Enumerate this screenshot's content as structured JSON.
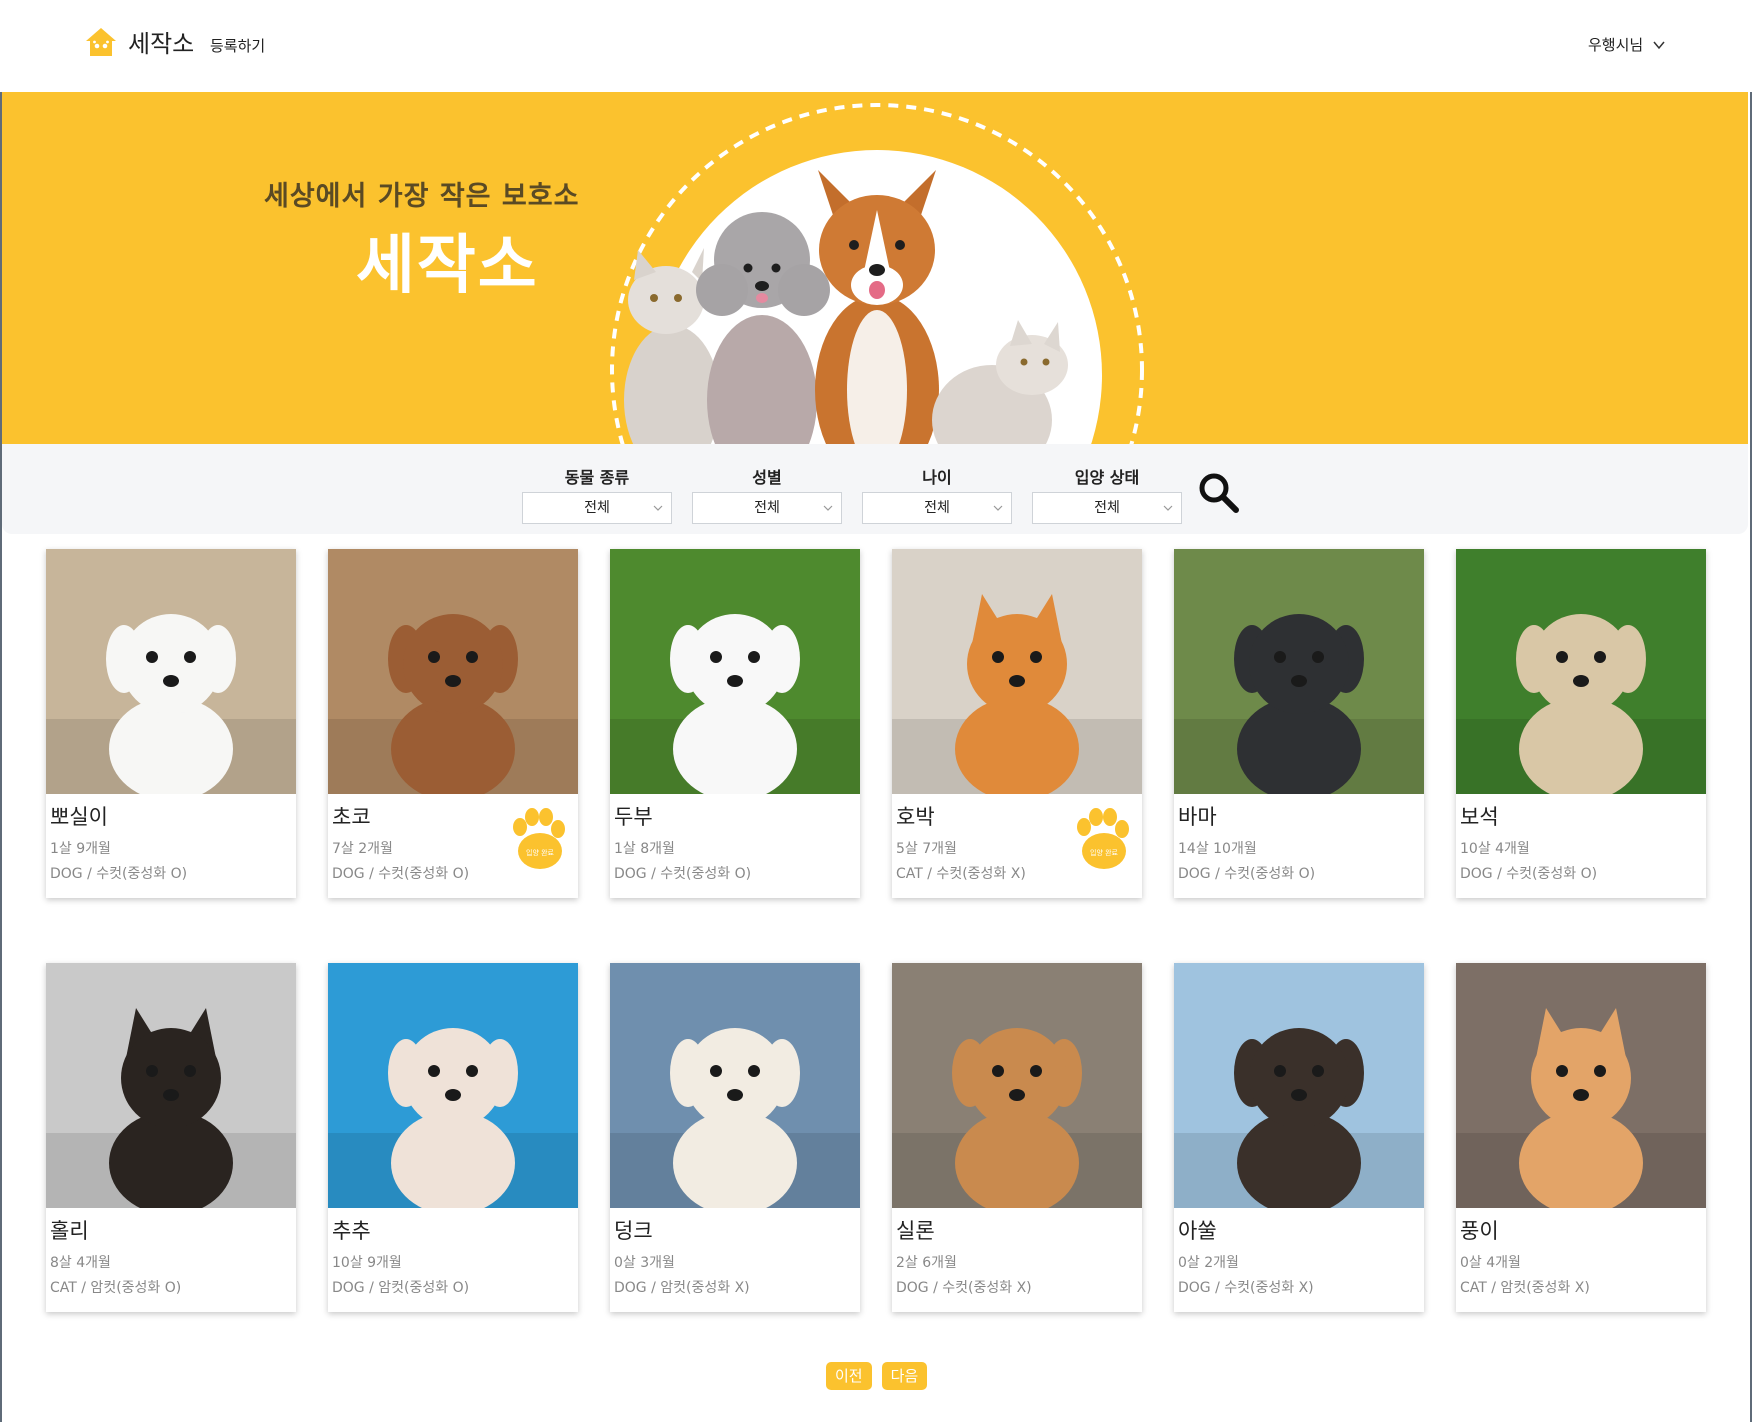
{
  "header": {
    "logo_text": "세작소",
    "register_label": "등록하기",
    "user_label": "우행시님"
  },
  "hero": {
    "subtitle": "세상에서 가장 작은 보호소",
    "title": "세작소"
  },
  "filters": [
    {
      "label": "동물 종류",
      "value": "전체"
    },
    {
      "label": "성별",
      "value": "전체"
    },
    {
      "label": "나이",
      "value": "전체"
    },
    {
      "label": "입양 상태",
      "value": "전체"
    }
  ],
  "pets": [
    {
      "name": "뽀실이",
      "age": "1살 9개월",
      "meta": "DOG / 수컷(중성화 O)",
      "adopted": false,
      "species": "dog",
      "bg": "#c7b59a",
      "fur": "#f7f7f5"
    },
    {
      "name": "초코",
      "age": "7살 2개월",
      "meta": "DOG / 수컷(중성화 O)",
      "adopted": true,
      "species": "dog",
      "bg": "#b08a64",
      "fur": "#9b5d34"
    },
    {
      "name": "두부",
      "age": "1살 8개월",
      "meta": "DOG / 수컷(중성화 O)",
      "adopted": false,
      "species": "dog",
      "bg": "#4e8a2e",
      "fur": "#f8f8f8"
    },
    {
      "name": "호박",
      "age": "5살 7개월",
      "meta": "CAT / 수컷(중성화 X)",
      "adopted": true,
      "species": "cat",
      "bg": "#d9d2c8",
      "fur": "#e08a3a"
    },
    {
      "name": "바마",
      "age": "14살 10개월",
      "meta": "DOG / 수컷(중성화 O)",
      "adopted": false,
      "species": "dog",
      "bg": "#6e8a4a",
      "fur": "#2e3033"
    },
    {
      "name": "보석",
      "age": "10살 4개월",
      "meta": "DOG / 수컷(중성화 O)",
      "adopted": false,
      "species": "dog",
      "bg": "#3f7f2c",
      "fur": "#d9c7a6"
    },
    {
      "name": "홀리",
      "age": "8살 4개월",
      "meta": "CAT / 암컷(중성화 O)",
      "adopted": false,
      "species": "cat",
      "bg": "#c9c9c9",
      "fur": "#2a2420"
    },
    {
      "name": "추추",
      "age": "10살 9개월",
      "meta": "DOG / 암컷(중성화 O)",
      "adopted": false,
      "species": "dog",
      "bg": "#2d9bd6",
      "fur": "#efe2d8"
    },
    {
      "name": "덩크",
      "age": "0살 3개월",
      "meta": "DOG / 암컷(중성화 X)",
      "adopted": false,
      "species": "dog",
      "bg": "#6f8fae",
      "fur": "#f2ece2"
    },
    {
      "name": "실론",
      "age": "2살 6개월",
      "meta": "DOG / 수컷(중성화 X)",
      "adopted": false,
      "species": "dog",
      "bg": "#8a8074",
      "fur": "#c98a4e"
    },
    {
      "name": "아쑬",
      "age": "0살 2개월",
      "meta": "DOG / 수컷(중성화 X)",
      "adopted": false,
      "species": "dog",
      "bg": "#9fc3df",
      "fur": "#3a302a"
    },
    {
      "name": "풍이",
      "age": "0살 4개월",
      "meta": "CAT / 암컷(중성화 X)",
      "adopted": false,
      "species": "cat",
      "bg": "#7d6f66",
      "fur": "#e3a468"
    }
  ],
  "badge_text": "입양 완료",
  "pager": {
    "prev_label": "이전",
    "next_label": "다음"
  },
  "colors": {
    "accent": "#fbc22e",
    "hero_bg": "#fbc22e",
    "filter_bg": "#f5f6f8"
  }
}
